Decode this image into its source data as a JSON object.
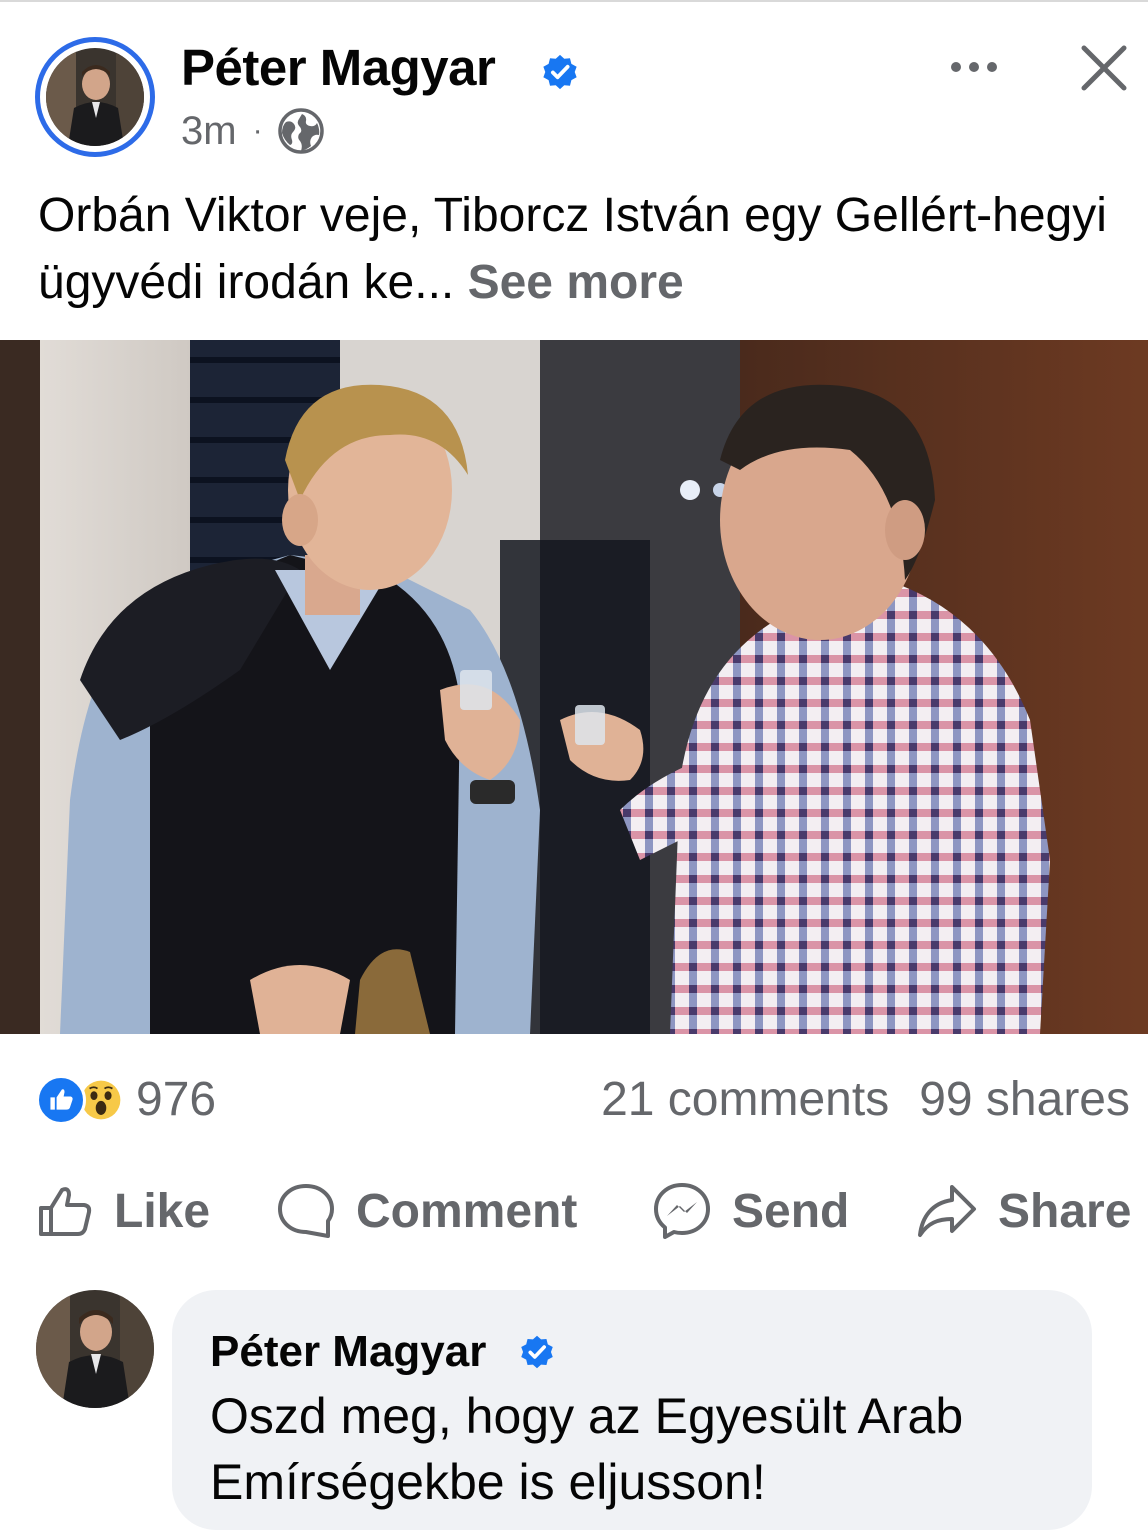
{
  "post": {
    "author": "Péter Magyar",
    "time": "3m",
    "separator": "·",
    "privacy_icon": "globe-icon",
    "text": "Orbán Viktor veje, Tiborcz István egy Gellért-hegyi ügyvédi irodán ke...",
    "see_more": "See more"
  },
  "engagement": {
    "reaction_icons": [
      "like-reaction-icon",
      "wow-reaction-icon"
    ],
    "reaction_count": "976",
    "comments": "21 comments",
    "shares": "99 shares"
  },
  "actions": {
    "like": "Like",
    "comment": "Comment",
    "send": "Send",
    "share": "Share"
  },
  "comment": {
    "author": "Péter Magyar",
    "text": "Oszd meg, hogy az Egyesült Arab Emírségekbe is eljusson!"
  },
  "colors": {
    "accent": "#1877f2",
    "story_ring": "#2d6be8",
    "secondary_text": "#65676b",
    "bubble": "#f0f2f5"
  }
}
